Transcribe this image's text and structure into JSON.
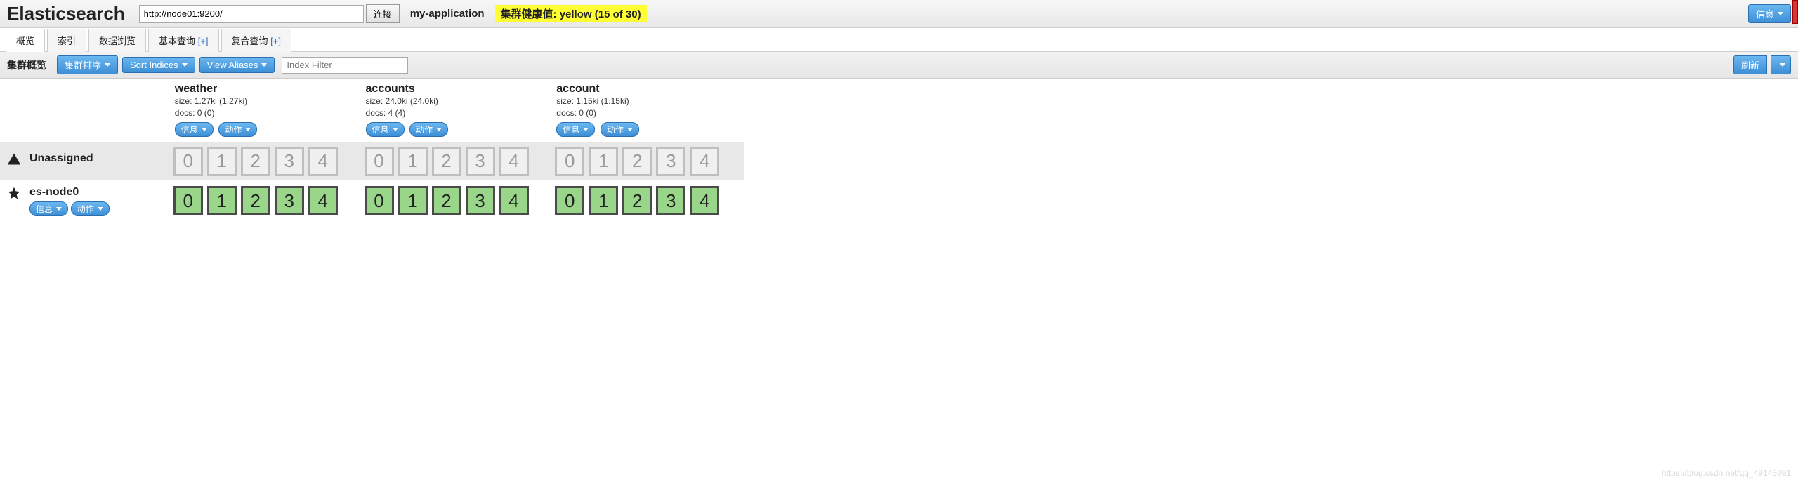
{
  "top": {
    "title": "Elasticsearch",
    "connect_url": "http://node01:9200/",
    "connect_btn": "连接",
    "cluster_name": "my-application",
    "health_text": "集群健康值: yellow (15 of 30)",
    "info_btn": "信息"
  },
  "tabs": {
    "overview": "概览",
    "indices": "索引",
    "browse": "数据浏览",
    "basic_query": "基本查询",
    "compound_query": "复合查询",
    "plus": "[+]"
  },
  "toolbar": {
    "label": "集群概览",
    "cluster_sort": "集群排序",
    "sort_indices": "Sort Indices",
    "view_aliases": "View Aliases",
    "filter_placeholder": "Index Filter",
    "refresh": "刷新"
  },
  "idx_btn": {
    "info": "信息",
    "action": "动作"
  },
  "indices": [
    {
      "name": "weather",
      "size": "size: 1.27ki (1.27ki)",
      "docs": "docs: 0 (0)"
    },
    {
      "name": "accounts",
      "size": "size: 24.0ki (24.0ki)",
      "docs": "docs: 4 (4)"
    },
    {
      "name": "account",
      "size": "size: 1.15ki (1.15ki)",
      "docs": "docs: 0 (0)"
    }
  ],
  "rows": {
    "unassigned_label": "Unassigned",
    "node0_label": "es-node0"
  },
  "shards": [
    "0",
    "1",
    "2",
    "3",
    "4"
  ],
  "watermark": "https://blog.csdn.net/qq_49145091"
}
